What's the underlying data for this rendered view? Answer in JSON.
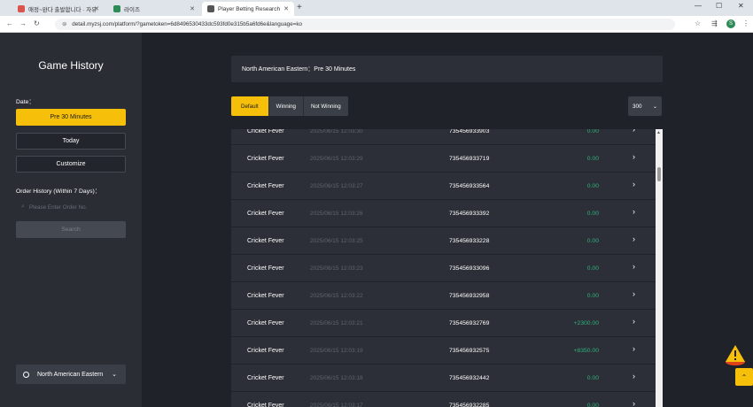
{
  "browser": {
    "tabs": [
      {
        "label": "애정~완다 출발합니다 · 자유",
        "fav_color": "#d9534f"
      },
      {
        "label": "라이즈",
        "fav_color": "#2e8b57"
      },
      {
        "label": "Player Betting Research",
        "fav_color": "#555555"
      }
    ],
    "url": "detail.myzsj.com/platform/?gametoken=6d8496530433dc593fd0e315b5a6fd6e&language=ko",
    "avatar": "S"
  },
  "sidebar": {
    "title": "Game History",
    "date_label": "Date：",
    "date_options": [
      "Pre 30 Minutes",
      "Today",
      "Customize"
    ],
    "order_label": "Order History (Within 7 Days)：",
    "order_placeholder": "Please Enter Order No.",
    "search_label": "Search",
    "region_label": "North American Eastern"
  },
  "main": {
    "header": "North American Eastern：Pre 30 Minutes",
    "filters": [
      "Default",
      "Winning",
      "Not Winning"
    ],
    "count": "300",
    "rows": [
      {
        "game": "Cricket Fever",
        "time": "2025/06/15 12:03:30",
        "order": "735456933903",
        "amount": "0.00"
      },
      {
        "game": "Cricket Fever",
        "time": "2025/06/15 12:03:29",
        "order": "735456933719",
        "amount": "0.00"
      },
      {
        "game": "Cricket Fever",
        "time": "2025/06/15 12:03:27",
        "order": "735456933564",
        "amount": "0.00"
      },
      {
        "game": "Cricket Fever",
        "time": "2025/06/15 12:03:26",
        "order": "735456933392",
        "amount": "0.00"
      },
      {
        "game": "Cricket Fever",
        "time": "2025/06/15 12:03:25",
        "order": "735456933228",
        "amount": "0.00"
      },
      {
        "game": "Cricket Fever",
        "time": "2025/06/15 12:03:23",
        "order": "735456933096",
        "amount": "0.00"
      },
      {
        "game": "Cricket Fever",
        "time": "2025/06/15 12:03:22",
        "order": "735456932958",
        "amount": "0.00"
      },
      {
        "game": "Cricket Fever",
        "time": "2025/06/15 12:03:21",
        "order": "735456932769",
        "amount": "+2300.00"
      },
      {
        "game": "Cricket Fever",
        "time": "2025/06/15 12:03:19",
        "order": "735456932575",
        "amount": "+8350.00"
      },
      {
        "game": "Cricket Fever",
        "time": "2025/06/15 12:03:18",
        "order": "735456932442",
        "amount": "0.00"
      },
      {
        "game": "Cricket Fever",
        "time": "2025/06/15 12:03:17",
        "order": "735456932285",
        "amount": "0.00"
      }
    ]
  },
  "colors": {
    "accent": "#f6bf0a",
    "win": "#2fb27a"
  }
}
